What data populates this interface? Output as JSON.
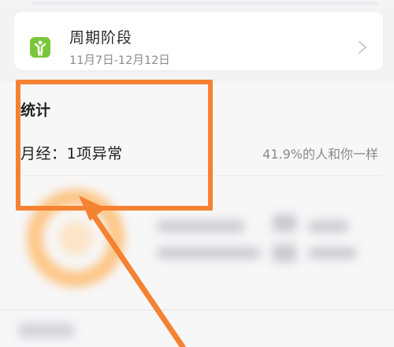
{
  "cycle_card": {
    "title": "周期阶段",
    "date_range": "11月7日-12月12日",
    "icon": "person-arms-up-icon",
    "icon_color": "#7ac63a"
  },
  "stats": {
    "title": "统计",
    "summary": "月经：1项异常",
    "percent_text": "41.9%的人和你一样"
  },
  "colors": {
    "accent_annotation": "#f58232",
    "ring": "#ffb45e",
    "background": "#f3f3f4",
    "card": "#ffffff"
  }
}
